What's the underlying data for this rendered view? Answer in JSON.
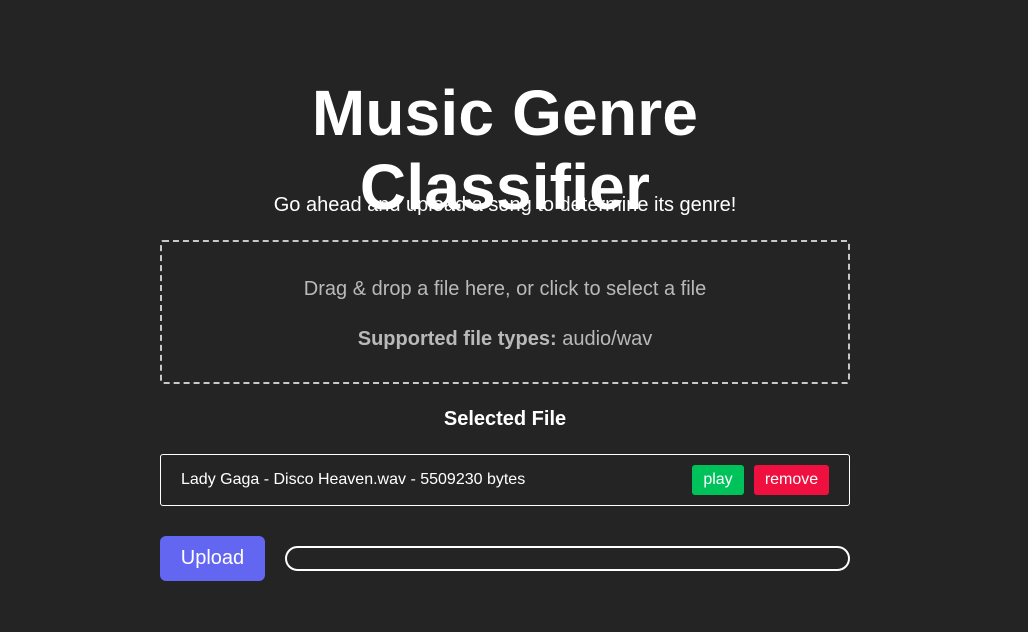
{
  "header": {
    "title": "Music Genre Classifier",
    "subtitle": "Go ahead and upload a song to determine its genre!"
  },
  "dropzone": {
    "prompt": "Drag & drop a file here, or click to select a file",
    "types_label": "Supported file types:",
    "types_value": "audio/wav"
  },
  "selected": {
    "heading": "Selected File",
    "file_text": "Lady Gaga - Disco Heaven.wav - 5509230 bytes",
    "play_label": "play",
    "remove_label": "remove"
  },
  "upload": {
    "button_label": "Upload",
    "progress_percent": 0
  },
  "colors": {
    "background": "#242424",
    "play": "#00c25a",
    "remove": "#f0103f",
    "accent": "#6366f1"
  }
}
